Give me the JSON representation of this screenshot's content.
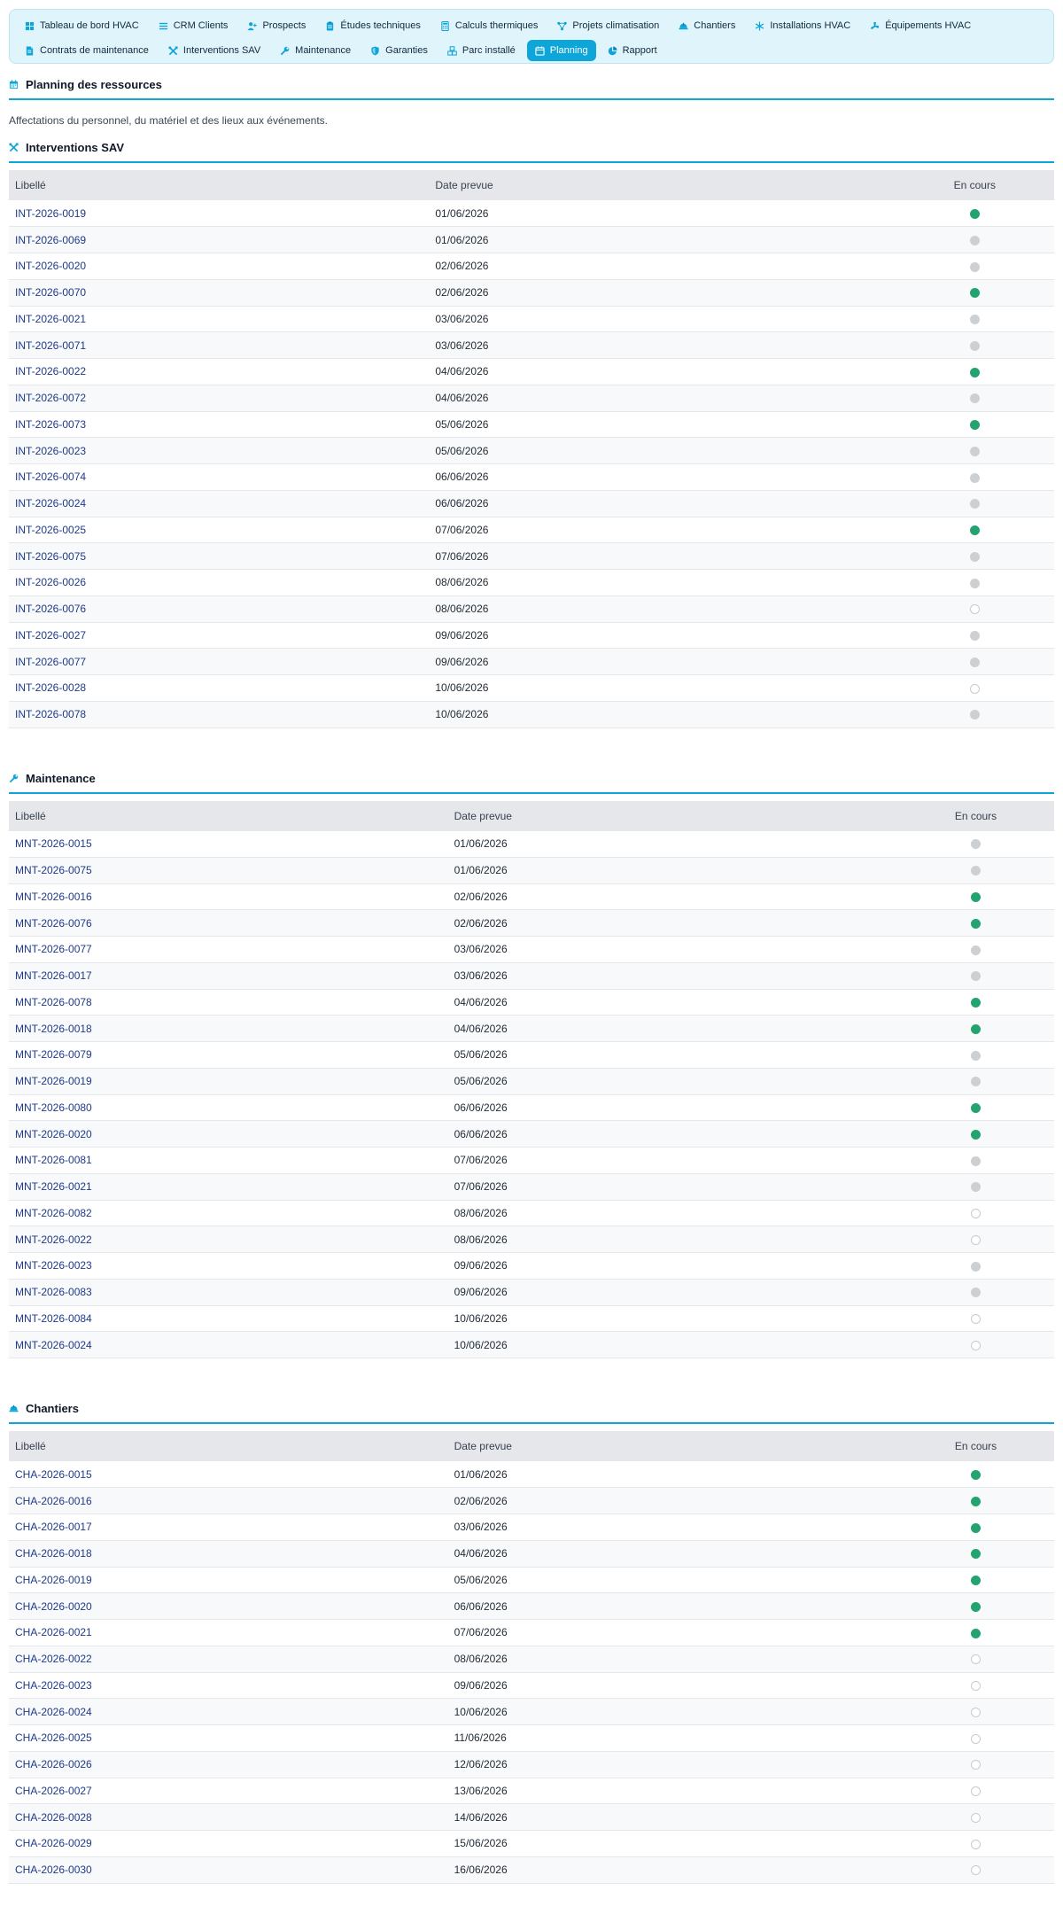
{
  "nav": [
    {
      "label": "Tableau de bord HVAC",
      "icon": "grid-icon"
    },
    {
      "label": "CRM Clients",
      "icon": "list-icon"
    },
    {
      "label": "Prospects",
      "icon": "user-plus-icon"
    },
    {
      "label": "Études techniques",
      "icon": "clipboard-icon"
    },
    {
      "label": "Calculs thermiques",
      "icon": "calculator-icon"
    },
    {
      "label": "Projets climatisation",
      "icon": "network-icon"
    },
    {
      "label": "Chantiers",
      "icon": "hard-hat-icon"
    },
    {
      "label": "Installations HVAC",
      "icon": "snowflake-icon"
    },
    {
      "label": "Équipements HVAC",
      "icon": "fan-icon"
    },
    {
      "label": "Contrats de maintenance",
      "icon": "contract-icon"
    },
    {
      "label": "Interventions SAV",
      "icon": "tools-icon"
    },
    {
      "label": "Maintenance",
      "icon": "wrench-icon"
    },
    {
      "label": "Garanties",
      "icon": "shield-icon"
    },
    {
      "label": "Parc installé",
      "icon": "boxes-icon"
    },
    {
      "label": "Planning",
      "icon": "calendar-icon",
      "active": true
    },
    {
      "label": "Rapport",
      "icon": "pie-chart-icon"
    }
  ],
  "page": {
    "title": "Planning des ressources",
    "subtitle": "Affectations du personnel, du matériel et des lieux aux événements."
  },
  "colors": {
    "accent": "#0ea5d8",
    "on": "#23a36f",
    "pending": "#cdd0d3",
    "link": "#1e3a8a"
  },
  "sections": [
    {
      "title": "Interventions SAV",
      "icon": "tools-icon",
      "headers": [
        "Libellé",
        "Date prevue",
        "En cours"
      ],
      "rows": [
        {
          "label": "INT-2026-0019",
          "date": "01/06/2026",
          "status": "on"
        },
        {
          "label": "INT-2026-0069",
          "date": "01/06/2026",
          "status": "grey"
        },
        {
          "label": "INT-2026-0020",
          "date": "02/06/2026",
          "status": "grey"
        },
        {
          "label": "INT-2026-0070",
          "date": "02/06/2026",
          "status": "on"
        },
        {
          "label": "INT-2026-0021",
          "date": "03/06/2026",
          "status": "grey"
        },
        {
          "label": "INT-2026-0071",
          "date": "03/06/2026",
          "status": "grey"
        },
        {
          "label": "INT-2026-0022",
          "date": "04/06/2026",
          "status": "on"
        },
        {
          "label": "INT-2026-0072",
          "date": "04/06/2026",
          "status": "grey"
        },
        {
          "label": "INT-2026-0073",
          "date": "05/06/2026",
          "status": "on"
        },
        {
          "label": "INT-2026-0023",
          "date": "05/06/2026",
          "status": "grey"
        },
        {
          "label": "INT-2026-0074",
          "date": "06/06/2026",
          "status": "grey"
        },
        {
          "label": "INT-2026-0024",
          "date": "06/06/2026",
          "status": "grey"
        },
        {
          "label": "INT-2026-0025",
          "date": "07/06/2026",
          "status": "on"
        },
        {
          "label": "INT-2026-0075",
          "date": "07/06/2026",
          "status": "grey"
        },
        {
          "label": "INT-2026-0026",
          "date": "08/06/2026",
          "status": "grey"
        },
        {
          "label": "INT-2026-0076",
          "date": "08/06/2026",
          "status": "off"
        },
        {
          "label": "INT-2026-0027",
          "date": "09/06/2026",
          "status": "grey"
        },
        {
          "label": "INT-2026-0077",
          "date": "09/06/2026",
          "status": "grey"
        },
        {
          "label": "INT-2026-0028",
          "date": "10/06/2026",
          "status": "off"
        },
        {
          "label": "INT-2026-0078",
          "date": "10/06/2026",
          "status": "grey"
        }
      ]
    },
    {
      "title": "Maintenance",
      "icon": "wrench-icon",
      "headers": [
        "Libellé",
        "Date prevue",
        "En cours"
      ],
      "rows": [
        {
          "label": "MNT-2026-0015",
          "date": "01/06/2026",
          "status": "grey"
        },
        {
          "label": "MNT-2026-0075",
          "date": "01/06/2026",
          "status": "grey"
        },
        {
          "label": "MNT-2026-0016",
          "date": "02/06/2026",
          "status": "on"
        },
        {
          "label": "MNT-2026-0076",
          "date": "02/06/2026",
          "status": "on"
        },
        {
          "label": "MNT-2026-0077",
          "date": "03/06/2026",
          "status": "grey"
        },
        {
          "label": "MNT-2026-0017",
          "date": "03/06/2026",
          "status": "grey"
        },
        {
          "label": "MNT-2026-0078",
          "date": "04/06/2026",
          "status": "on"
        },
        {
          "label": "MNT-2026-0018",
          "date": "04/06/2026",
          "status": "on"
        },
        {
          "label": "MNT-2026-0079",
          "date": "05/06/2026",
          "status": "grey"
        },
        {
          "label": "MNT-2026-0019",
          "date": "05/06/2026",
          "status": "grey"
        },
        {
          "label": "MNT-2026-0080",
          "date": "06/06/2026",
          "status": "on"
        },
        {
          "label": "MNT-2026-0020",
          "date": "06/06/2026",
          "status": "on"
        },
        {
          "label": "MNT-2026-0081",
          "date": "07/06/2026",
          "status": "grey"
        },
        {
          "label": "MNT-2026-0021",
          "date": "07/06/2026",
          "status": "grey"
        },
        {
          "label": "MNT-2026-0082",
          "date": "08/06/2026",
          "status": "off"
        },
        {
          "label": "MNT-2026-0022",
          "date": "08/06/2026",
          "status": "off"
        },
        {
          "label": "MNT-2026-0023",
          "date": "09/06/2026",
          "status": "grey"
        },
        {
          "label": "MNT-2026-0083",
          "date": "09/06/2026",
          "status": "grey"
        },
        {
          "label": "MNT-2026-0084",
          "date": "10/06/2026",
          "status": "off"
        },
        {
          "label": "MNT-2026-0024",
          "date": "10/06/2026",
          "status": "off"
        }
      ]
    },
    {
      "title": "Chantiers",
      "icon": "hard-hat-icon",
      "headers": [
        "Libellé",
        "Date prevue",
        "En cours"
      ],
      "rows": [
        {
          "label": "CHA-2026-0015",
          "date": "01/06/2026",
          "status": "on"
        },
        {
          "label": "CHA-2026-0016",
          "date": "02/06/2026",
          "status": "on"
        },
        {
          "label": "CHA-2026-0017",
          "date": "03/06/2026",
          "status": "on"
        },
        {
          "label": "CHA-2026-0018",
          "date": "04/06/2026",
          "status": "on"
        },
        {
          "label": "CHA-2026-0019",
          "date": "05/06/2026",
          "status": "on"
        },
        {
          "label": "CHA-2026-0020",
          "date": "06/06/2026",
          "status": "on"
        },
        {
          "label": "CHA-2026-0021",
          "date": "07/06/2026",
          "status": "on"
        },
        {
          "label": "CHA-2026-0022",
          "date": "08/06/2026",
          "status": "off"
        },
        {
          "label": "CHA-2026-0023",
          "date": "09/06/2026",
          "status": "off"
        },
        {
          "label": "CHA-2026-0024",
          "date": "10/06/2026",
          "status": "off"
        },
        {
          "label": "CHA-2026-0025",
          "date": "11/06/2026",
          "status": "off"
        },
        {
          "label": "CHA-2026-0026",
          "date": "12/06/2026",
          "status": "off"
        },
        {
          "label": "CHA-2026-0027",
          "date": "13/06/2026",
          "status": "off"
        },
        {
          "label": "CHA-2026-0028",
          "date": "14/06/2026",
          "status": "off"
        },
        {
          "label": "CHA-2026-0029",
          "date": "15/06/2026",
          "status": "off"
        },
        {
          "label": "CHA-2026-0030",
          "date": "16/06/2026",
          "status": "off"
        }
      ]
    }
  ]
}
